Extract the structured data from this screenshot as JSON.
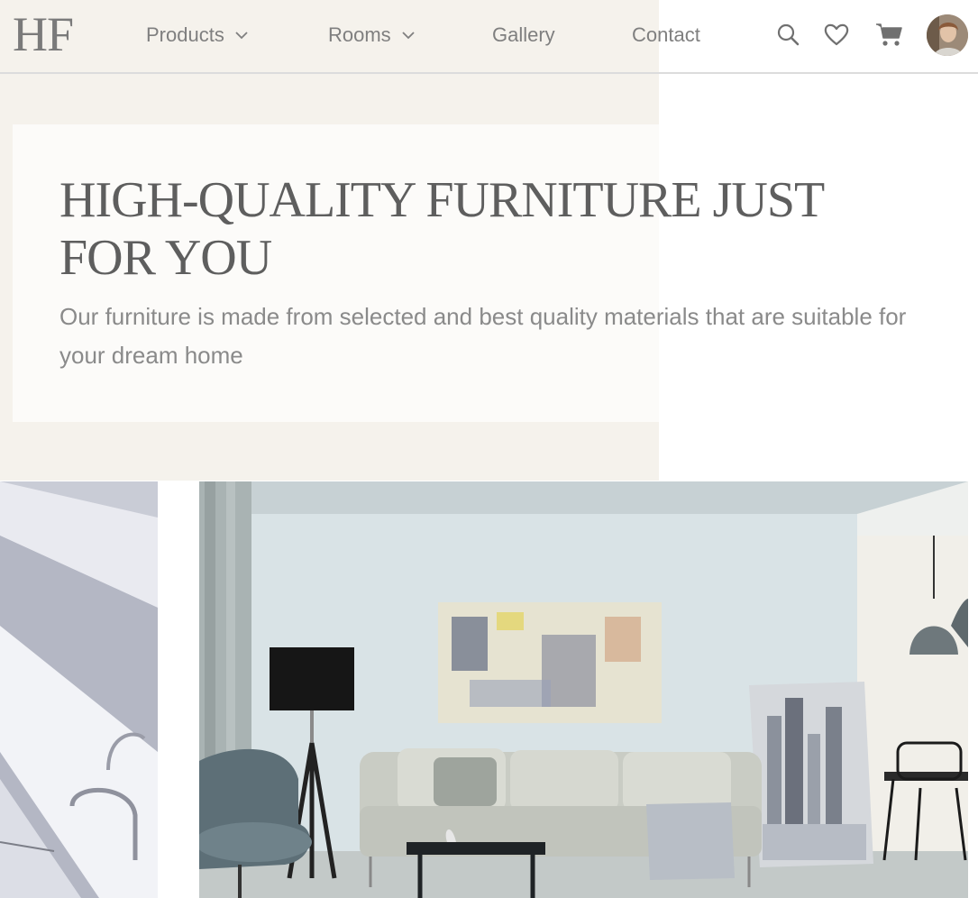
{
  "brand": {
    "logo": "HF"
  },
  "nav": {
    "items": [
      {
        "label": "Products",
        "has_dropdown": true
      },
      {
        "label": "Rooms",
        "has_dropdown": true
      },
      {
        "label": "Gallery",
        "has_dropdown": false
      },
      {
        "label": "Contact",
        "has_dropdown": false
      }
    ],
    "icons": [
      "search-icon",
      "heart-icon",
      "cart-icon",
      "user-avatar"
    ]
  },
  "hero": {
    "title": "HIGH-QUALITY FURNITURE JUST FOR YOU",
    "subtitle": "Our furniture is made from selected and best quality materials that are suitable for your dream home"
  },
  "colors": {
    "background_beige": "#f5f2ec",
    "text_gray": "#7f7f7f",
    "title_gray": "#5e5e5e",
    "divider": "#dcdcdc"
  }
}
